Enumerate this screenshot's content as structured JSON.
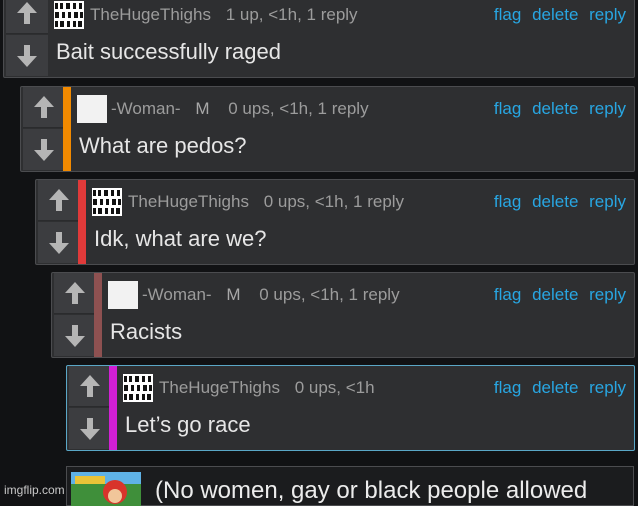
{
  "comments": [
    {
      "username": "TheHugeThighs",
      "role": "",
      "stats": "1 up, <1h, 1 reply",
      "text": "Bait successfully raged",
      "bar_color": "",
      "avatar": "pixel-avatar"
    },
    {
      "username": "-Woman-",
      "role": "M",
      "stats": "0 ups, <1h, 1 reply",
      "text": "What are pedos?",
      "bar_color": "#f28a00",
      "avatar": "blank-avatar"
    },
    {
      "username": "TheHugeThighs",
      "role": "",
      "stats": "0 ups, <1h, 1 reply",
      "text": "Idk, what are we?",
      "bar_color": "#e03a3a",
      "avatar": "pixel-avatar"
    },
    {
      "username": "-Woman-",
      "role": "M",
      "stats": "0 ups, <1h, 1 reply",
      "text": "Racists",
      "bar_color": "#8e5151",
      "avatar": "blank-avatar"
    },
    {
      "username": "TheHugeThighs",
      "role": "",
      "stats": "0 ups, <1h",
      "text": "Let’s go race",
      "bar_color": "#d21fd6",
      "avatar": "pixel-avatar"
    }
  ],
  "actions": {
    "flag": "flag",
    "delete": "delete",
    "reply": "reply"
  },
  "bottom": {
    "text": "(No women, gay or black people allowed"
  },
  "watermark": "imgflip.com",
  "colors": {
    "link": "#28a6e2",
    "panel": "#2e2f31",
    "background": "#111214"
  },
  "icons": [
    "up-arrow-icon",
    "down-arrow-icon"
  ]
}
